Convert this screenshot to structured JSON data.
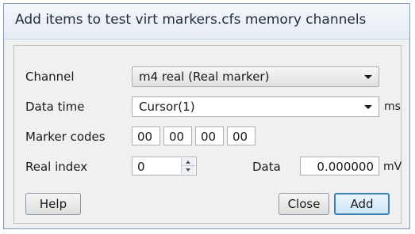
{
  "window": {
    "title": "Add items to test virt markers.cfs memory channels"
  },
  "channel": {
    "label": "Channel",
    "value": "m4 real (Real marker)"
  },
  "data_time": {
    "label": "Data time",
    "value": "Cursor(1)",
    "unit": "ms"
  },
  "marker_codes": {
    "label": "Marker codes",
    "codes": [
      "00",
      "00",
      "00",
      "00"
    ]
  },
  "real_index": {
    "label": "Real index",
    "value": "0"
  },
  "data": {
    "label": "Data",
    "value": "0.000000",
    "unit": "mV"
  },
  "buttons": {
    "help": "Help",
    "close": "Close",
    "add": "Add"
  }
}
